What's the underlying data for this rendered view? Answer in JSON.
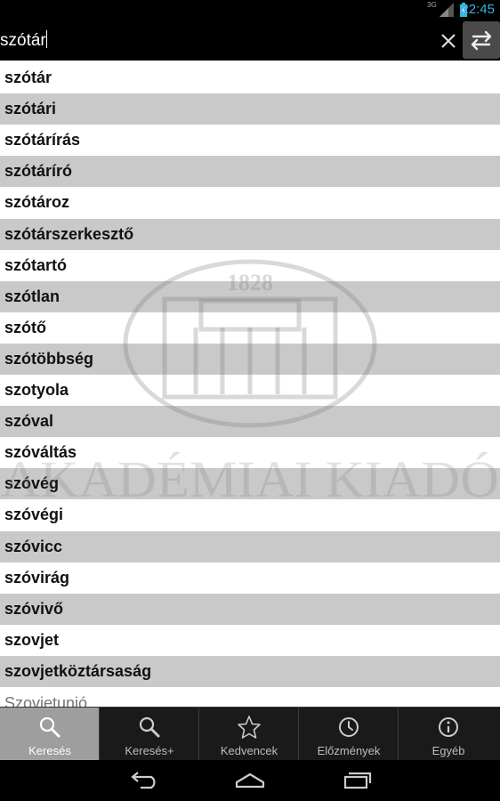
{
  "status_bar": {
    "network": "3G",
    "time": "22:45"
  },
  "search": {
    "value": "szótár"
  },
  "results": [
    "szótár",
    "szótári",
    "szótárírás",
    "szótáríró",
    "szótároz",
    "szótárszerkesztő",
    "szótartó",
    "szótlan",
    "szótő",
    "szótöbbség",
    "szotyola",
    "szóval",
    "szóváltás",
    "szóvég",
    "szóvégi",
    "szóvicc",
    "szóvirág",
    "szóvivő",
    "szovjet",
    "szovjetköztársaság",
    "Szovjetunió"
  ],
  "watermark": {
    "year": "1828",
    "publisher": "AKADÉMIAI KIADÓ"
  },
  "tabs": [
    {
      "label": "Keresés",
      "icon": "search-icon",
      "active": true
    },
    {
      "label": "Keresés+",
      "icon": "search-plus-icon",
      "active": false
    },
    {
      "label": "Kedvencek",
      "icon": "star-icon",
      "active": false
    },
    {
      "label": "Előzmények",
      "icon": "clock-icon",
      "active": false
    },
    {
      "label": "Egyéb",
      "icon": "info-icon",
      "active": false
    }
  ],
  "colors": {
    "time": "#33b5e5",
    "row_dark": "#c9c9c9",
    "tab_active": "#9e9e9e"
  }
}
